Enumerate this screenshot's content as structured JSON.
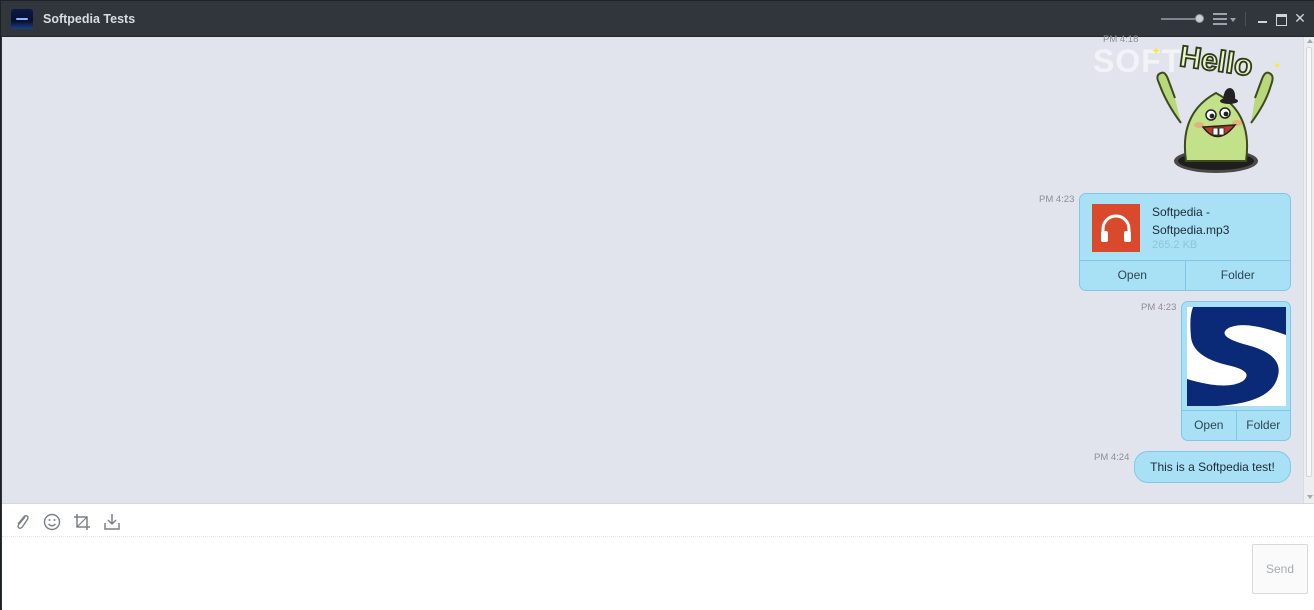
{
  "window": {
    "title": "Softpedia Tests",
    "accent_color": "#30363c"
  },
  "titlebar": {
    "icons": [
      "app-icon",
      "volume-slider",
      "menu-icon",
      "minimize-icon",
      "maximize-icon",
      "close-icon"
    ],
    "volume_level": 0.85
  },
  "chat": {
    "background_color": "#e1e4ec",
    "bubble_color": "#a8e1f6",
    "messages": [
      {
        "type": "sticker",
        "time": "PM 4:18",
        "sticker_text": "Hello",
        "watermark": "SOFT"
      },
      {
        "type": "file",
        "time": "PM 4:23",
        "file_name": "Softpedia - Softpedia.mp3",
        "file_size": "265.2 KB",
        "icon": "headphones-icon",
        "open_label": "Open",
        "folder_label": "Folder"
      },
      {
        "type": "image",
        "time": "PM 4:23",
        "icon": "softpedia-s-logo",
        "open_label": "Open",
        "folder_label": "Folder"
      },
      {
        "type": "text",
        "time": "PM 4:24",
        "text": "This is a Softpedia test!"
      }
    ]
  },
  "composer": {
    "tools": [
      "attach-icon",
      "emoji-icon",
      "crop-icon",
      "save-icon"
    ],
    "placeholder": "",
    "send_label": "Send"
  }
}
